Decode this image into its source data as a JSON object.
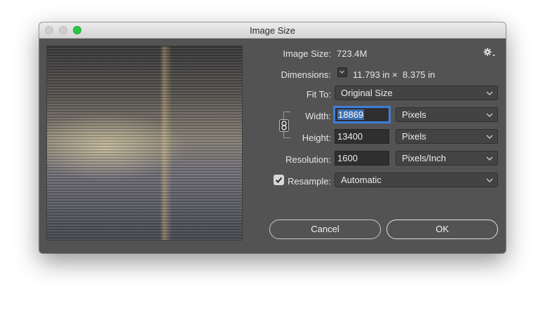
{
  "window": {
    "title": "Image Size"
  },
  "info": {
    "image_size_label": "Image Size:",
    "image_size_value": "723.4M",
    "dimensions_label": "Dimensions:",
    "dim_width": "11.793 in",
    "dim_separator": "×",
    "dim_height": "8.375 in"
  },
  "fit_to": {
    "label": "Fit To:",
    "value": "Original Size"
  },
  "width": {
    "label": "Width:",
    "value": "18869",
    "unit": "Pixels"
  },
  "height": {
    "label": "Height:",
    "value": "13400",
    "unit": "Pixels"
  },
  "resolution": {
    "label": "Resolution:",
    "value": "1600",
    "unit": "Pixels/Inch"
  },
  "resample": {
    "label": "Resample:",
    "checked": true,
    "value": "Automatic"
  },
  "buttons": {
    "cancel": "Cancel",
    "ok": "OK"
  },
  "icons": {
    "gear": "gear-icon",
    "chain": "chain-link-icon",
    "chevron": "chevron-down-icon",
    "check": "checkmark-icon"
  },
  "colors": {
    "window_bg": "#535353",
    "focus_ring": "#3d7ed9",
    "zoom_button": "#28c940"
  }
}
